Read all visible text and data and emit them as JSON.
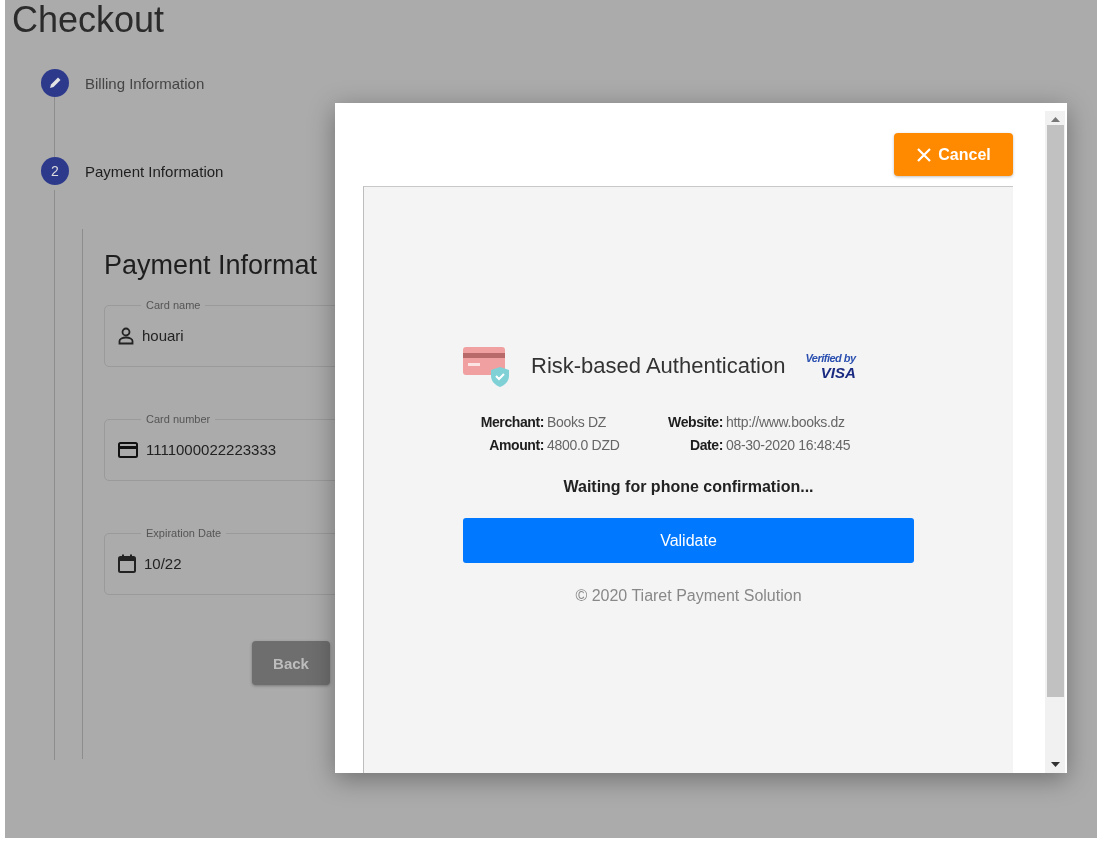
{
  "page": {
    "title": "Checkout",
    "steps": [
      {
        "label": "Billing Information",
        "completed": true,
        "active": false
      },
      {
        "label": "Payment Information",
        "number": "2",
        "completed": false,
        "active": true
      }
    ],
    "section_title": "Payment Informat",
    "fields": [
      {
        "label": "Card name",
        "value": "houari",
        "kind": "person"
      },
      {
        "label": "Card number",
        "value": "1111000022223333",
        "kind": "card"
      },
      {
        "label": "Expiration Date",
        "value": "10/22",
        "kind": "calendar"
      }
    ],
    "back_button": "Back"
  },
  "dialog": {
    "cancel_button": "Cancel",
    "title": "Risk-based Authentication",
    "badge": {
      "line_1": "Verified by",
      "line_2": "VISA"
    },
    "details": [
      {
        "label": "Merchant:",
        "value": "Books DZ"
      },
      {
        "label": "Website:",
        "value": "http://www.books.dz"
      },
      {
        "label": "Amount:",
        "value": "4800.0 DZD"
      },
      {
        "label": "Date:",
        "value": "08-30-2020 16:48:45"
      }
    ],
    "status": "Waiting for phone confirmation...",
    "validate_button": "Validate",
    "footer": "© 2020 Tiaret Payment Solution"
  }
}
